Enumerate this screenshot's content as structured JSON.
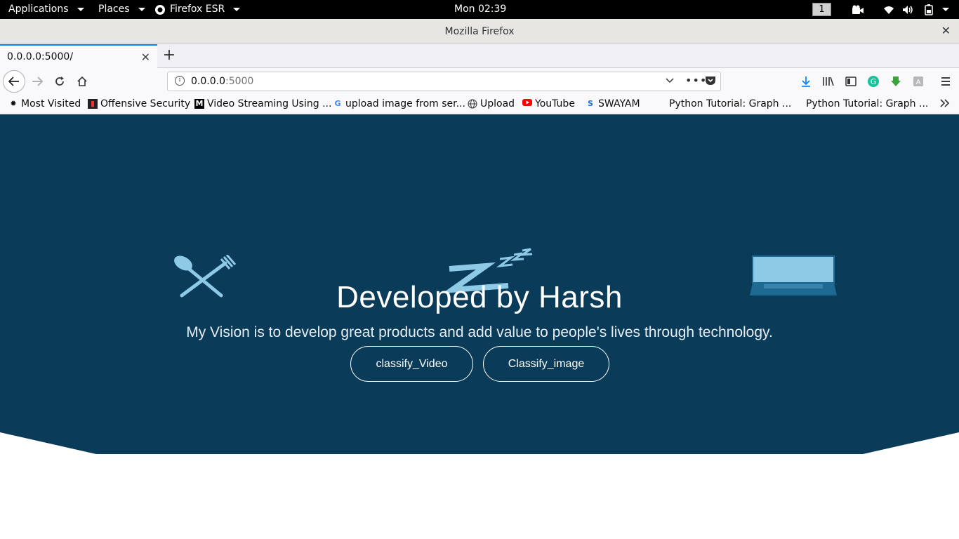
{
  "topbar": {
    "applications": "Applications",
    "places": "Places",
    "app_name": "Firefox ESR",
    "clock": "Mon 02:39",
    "workspace": "1"
  },
  "window": {
    "title": "Mozilla Firefox",
    "close": "✕"
  },
  "tabs": [
    {
      "label": "0.0.0.0:5000/",
      "active": true
    }
  ],
  "new_tab": "+",
  "urlbar": {
    "host": "0.0.0.0",
    "port": ":5000"
  },
  "bookmarks": [
    {
      "label": "Most Visited",
      "icon": "gear-icon"
    },
    {
      "label": "Offensive Security",
      "icon": "offsec-icon"
    },
    {
      "label": "Video Streaming Using ...",
      "icon": "medium-icon"
    },
    {
      "label": "upload image from ser...",
      "icon": "google-icon"
    },
    {
      "label": "Upload",
      "icon": "globe-icon"
    },
    {
      "label": "YouTube",
      "icon": "youtube-icon"
    },
    {
      "label": "SWAYAM",
      "icon": "swayam-icon"
    },
    {
      "label": "Python Tutorial: Graph ...",
      "icon": ""
    },
    {
      "label": "Python Tutorial: Graph ...",
      "icon": ""
    }
  ],
  "hero": {
    "title": "Developed by Harsh",
    "subtitle": "My Vision is to develop great products and add value to people's lives through technology.",
    "buttons": {
      "video": "classify_Video",
      "image": "Classify_image"
    },
    "background": "#0a3b58",
    "icon_color": "#8ecae6"
  }
}
